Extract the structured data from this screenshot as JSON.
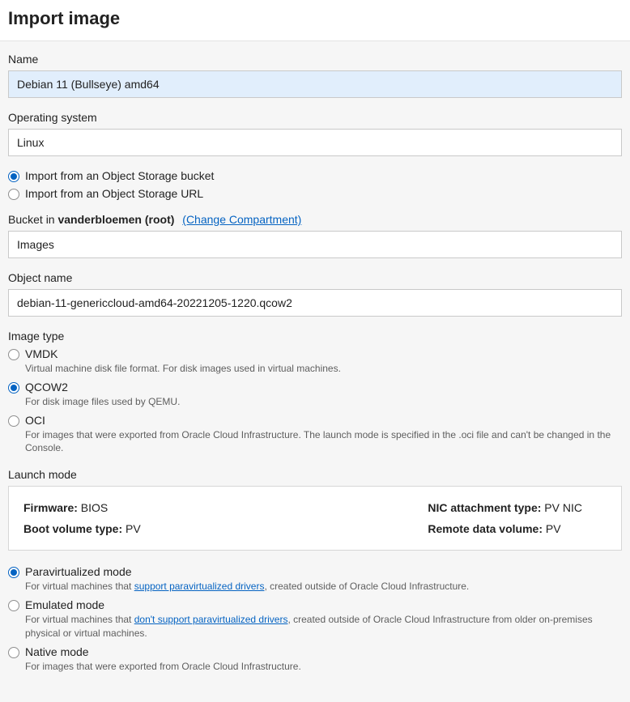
{
  "header": {
    "title": "Import image"
  },
  "nameField": {
    "label": "Name",
    "value": "Debian 11 (Bullseye) amd64"
  },
  "osField": {
    "label": "Operating system",
    "value": "Linux"
  },
  "importSource": {
    "selected": "bucket",
    "options": {
      "bucket": {
        "label": "Import from an Object Storage bucket"
      },
      "url": {
        "label": "Import from an Object Storage URL"
      }
    }
  },
  "bucket": {
    "prefix": "Bucket in ",
    "compartment": "vanderbloemen (root)",
    "changeLink": "(Change Compartment)",
    "value": "Images"
  },
  "objectName": {
    "label": "Object name",
    "value": "debian-11-genericcloud-amd64-20221205-1220.qcow2"
  },
  "imageType": {
    "heading": "Image type",
    "selected": "qcow2",
    "options": {
      "vmdk": {
        "label": "VMDK",
        "desc": "Virtual machine disk file format. For disk images used in virtual machines."
      },
      "qcow2": {
        "label": "QCOW2",
        "desc": "For disk image files used by QEMU."
      },
      "oci": {
        "label": "OCI",
        "desc": "For images that were exported from Oracle Cloud Infrastructure. The launch mode is specified in the .oci file and can't be changed in the Console."
      }
    }
  },
  "launchMode": {
    "heading": "Launch mode",
    "info": {
      "firmware": {
        "key": "Firmware:",
        "value": " BIOS"
      },
      "bootVolume": {
        "key": "Boot volume type:",
        "value": " PV"
      },
      "nic": {
        "key": "NIC attachment type:",
        "value": " PV NIC"
      },
      "remote": {
        "key": "Remote data volume:",
        "value": " PV"
      }
    },
    "selected": "paravirtualized",
    "options": {
      "paravirtualized": {
        "label": "Paravirtualized mode",
        "desc1": "For virtual machines that ",
        "link": "support paravirtualized drivers",
        "desc2": ", created outside of Oracle Cloud Infrastructure."
      },
      "emulated": {
        "label": "Emulated mode",
        "desc1": "For virtual machines that ",
        "link": "don't support paravirtualized drivers",
        "desc2": ", created outside of Oracle Cloud Infrastructure from older on-premises physical or virtual machines."
      },
      "native": {
        "label": "Native mode",
        "desc": "For images that were exported from Oracle Cloud Infrastructure."
      }
    }
  }
}
